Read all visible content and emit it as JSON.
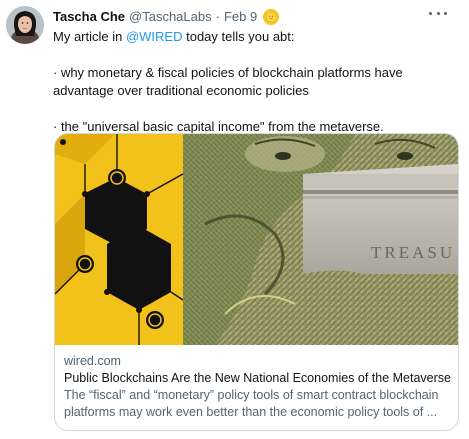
{
  "tweet": {
    "author_name": "Tascha Che",
    "author_handle": "@TaschaLabs",
    "separator": "·",
    "date": "Feb 9",
    "text_line1_prefix": "My article in ",
    "text_line1_mention": "@WIRED",
    "text_line1_suffix": " today tells you abt:",
    "bullet1": "· why monetary & fiscal policies of blockchain platforms have advantage over traditional economic policies",
    "bullet2": "· the \"universal basic capital income\" from the metaverse."
  },
  "card": {
    "domain": "wired.com",
    "title": "Public Blockchains Are the New National Economies of the Metaverse",
    "description": "The “fiscal” and “monetary” policy tools of smart contract blockchain platforms may work even better than the economic policy tools of ...",
    "image_engraving": "TREASU"
  },
  "icons": {
    "more": "more-horizontal-icon",
    "badge": "sun-emoji-icon"
  },
  "colors": {
    "text": "#0f1419",
    "muted": "#536471",
    "link": "#1d9bf0",
    "border": "#cfd9de",
    "yellow": "#f3c21a"
  }
}
